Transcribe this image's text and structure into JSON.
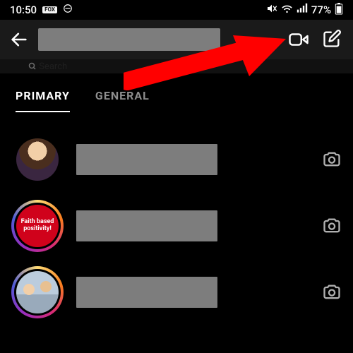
{
  "status": {
    "time": "10:50",
    "carrier_badge": "FOX",
    "battery": "77%"
  },
  "header": {
    "back_label": "Back"
  },
  "search": {
    "placeholder": "Search"
  },
  "tabs": {
    "primary": "PRIMARY",
    "general": "GENERAL"
  },
  "chats": [
    {
      "avatar_text": "",
      "has_story_ring": false,
      "camera": true
    },
    {
      "avatar_text": "Faith based positivity!",
      "has_story_ring": true,
      "camera": true
    },
    {
      "avatar_text": "",
      "has_story_ring": true,
      "camera": true
    }
  ],
  "annotation": {
    "arrow_points_to": "video-call-button",
    "color": "#ff0000"
  }
}
